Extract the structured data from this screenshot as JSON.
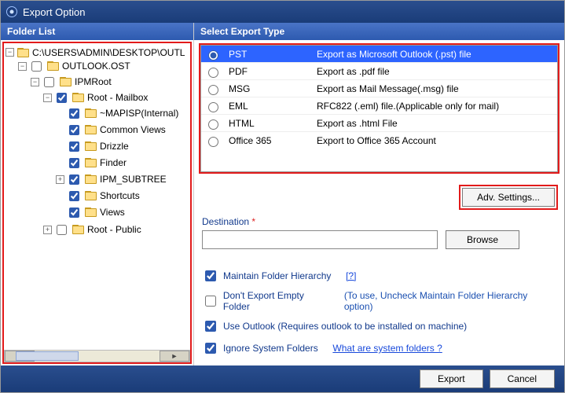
{
  "window": {
    "title": "Export Option"
  },
  "left": {
    "header": "Folder List"
  },
  "tree": {
    "root_path": "C:\\USERS\\ADMIN\\DESKTOP\\OUTL",
    "ost": "OUTLOOK.OST",
    "ipmroot": "IPMRoot",
    "root_mailbox": "Root - Mailbox",
    "children": [
      "~MAPISP(Internal)",
      "Common Views",
      "Drizzle",
      "Finder",
      "IPM_SUBTREE",
      "Shortcuts",
      "Views"
    ],
    "root_public": "Root - Public"
  },
  "right": {
    "header": "Select Export Type"
  },
  "exports": [
    {
      "code": "PST",
      "desc": "Export as Microsoft Outlook (.pst) file",
      "selected": true
    },
    {
      "code": "PDF",
      "desc": "Export as .pdf file",
      "selected": false
    },
    {
      "code": "MSG",
      "desc": "Export as Mail Message(.msg) file",
      "selected": false
    },
    {
      "code": "EML",
      "desc": "RFC822 (.eml) file.(Applicable only for mail)",
      "selected": false
    },
    {
      "code": "HTML",
      "desc": "Export as .html File",
      "selected": false
    },
    {
      "code": "Office 365",
      "desc": "Export to Office 365 Account",
      "selected": false
    }
  ],
  "buttons": {
    "adv": "Adv. Settings...",
    "browse": "Browse",
    "export": "Export",
    "cancel": "Cancel"
  },
  "destination": {
    "label": "Destination",
    "value": ""
  },
  "options": {
    "maintain": {
      "label": "Maintain Folder Hierarchy",
      "checked": true,
      "help": "[?]"
    },
    "noempty": {
      "label": "Don't Export Empty Folder",
      "checked": false,
      "note": "(To use, Uncheck Maintain Folder Hierarchy option)"
    },
    "useoutlook": {
      "label": "Use Outlook (Requires outlook to be installed on machine)",
      "checked": true
    },
    "ignoresys": {
      "label": "Ignore System Folders",
      "checked": true,
      "link": "What are system folders ?"
    }
  }
}
